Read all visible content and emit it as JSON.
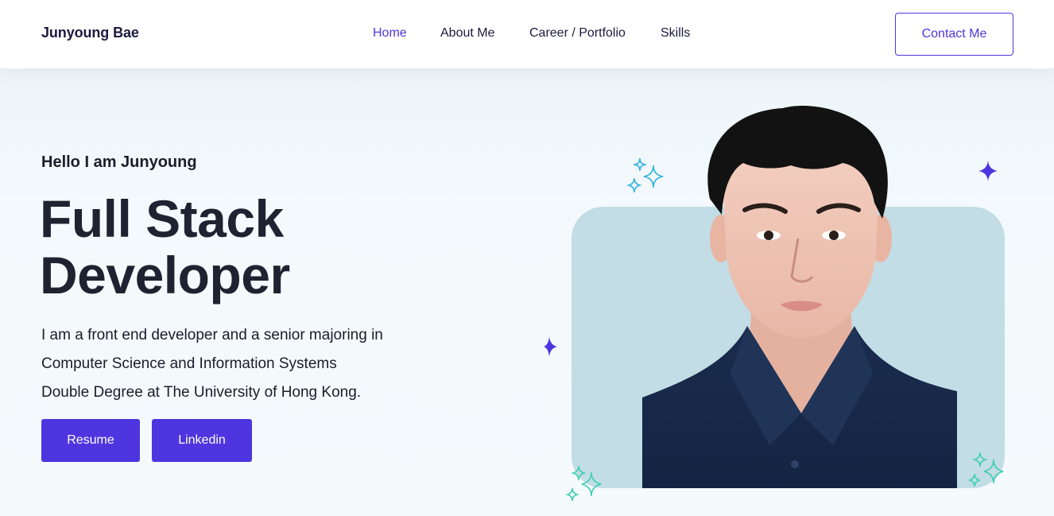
{
  "header": {
    "brand": "Junyoung Bae",
    "nav": [
      {
        "label": "Home",
        "active": true
      },
      {
        "label": "About Me",
        "active": false
      },
      {
        "label": "Career / Portfolio",
        "active": false
      },
      {
        "label": "Skills",
        "active": false
      }
    ],
    "contact_label": "Contact Me"
  },
  "hero": {
    "greeting": "Hello I am Junyoung",
    "headline_line1": "Full Stack",
    "headline_line2": "Developer",
    "intro_line1": "I am a front end developer and a senior majoring in",
    "intro_line2": "Computer Science and Information Systems",
    "intro_line3": "Double Degree at The University of Hong Kong.",
    "buttons": {
      "resume": "Resume",
      "linkedin": "Linkedin"
    }
  },
  "colors": {
    "accent": "#4f35e0",
    "text_dark": "#1c1a3e",
    "hero_bg": "#f2f8fc",
    "photo_card": "#c2dde6",
    "sparkle_blue": "#2bb4e0",
    "sparkle_teal": "#3fcfb0",
    "sparkle_purple": "#4f35e0"
  },
  "icons": {
    "sparkles": [
      "sparkle-cluster-icon",
      "star-icon"
    ]
  }
}
